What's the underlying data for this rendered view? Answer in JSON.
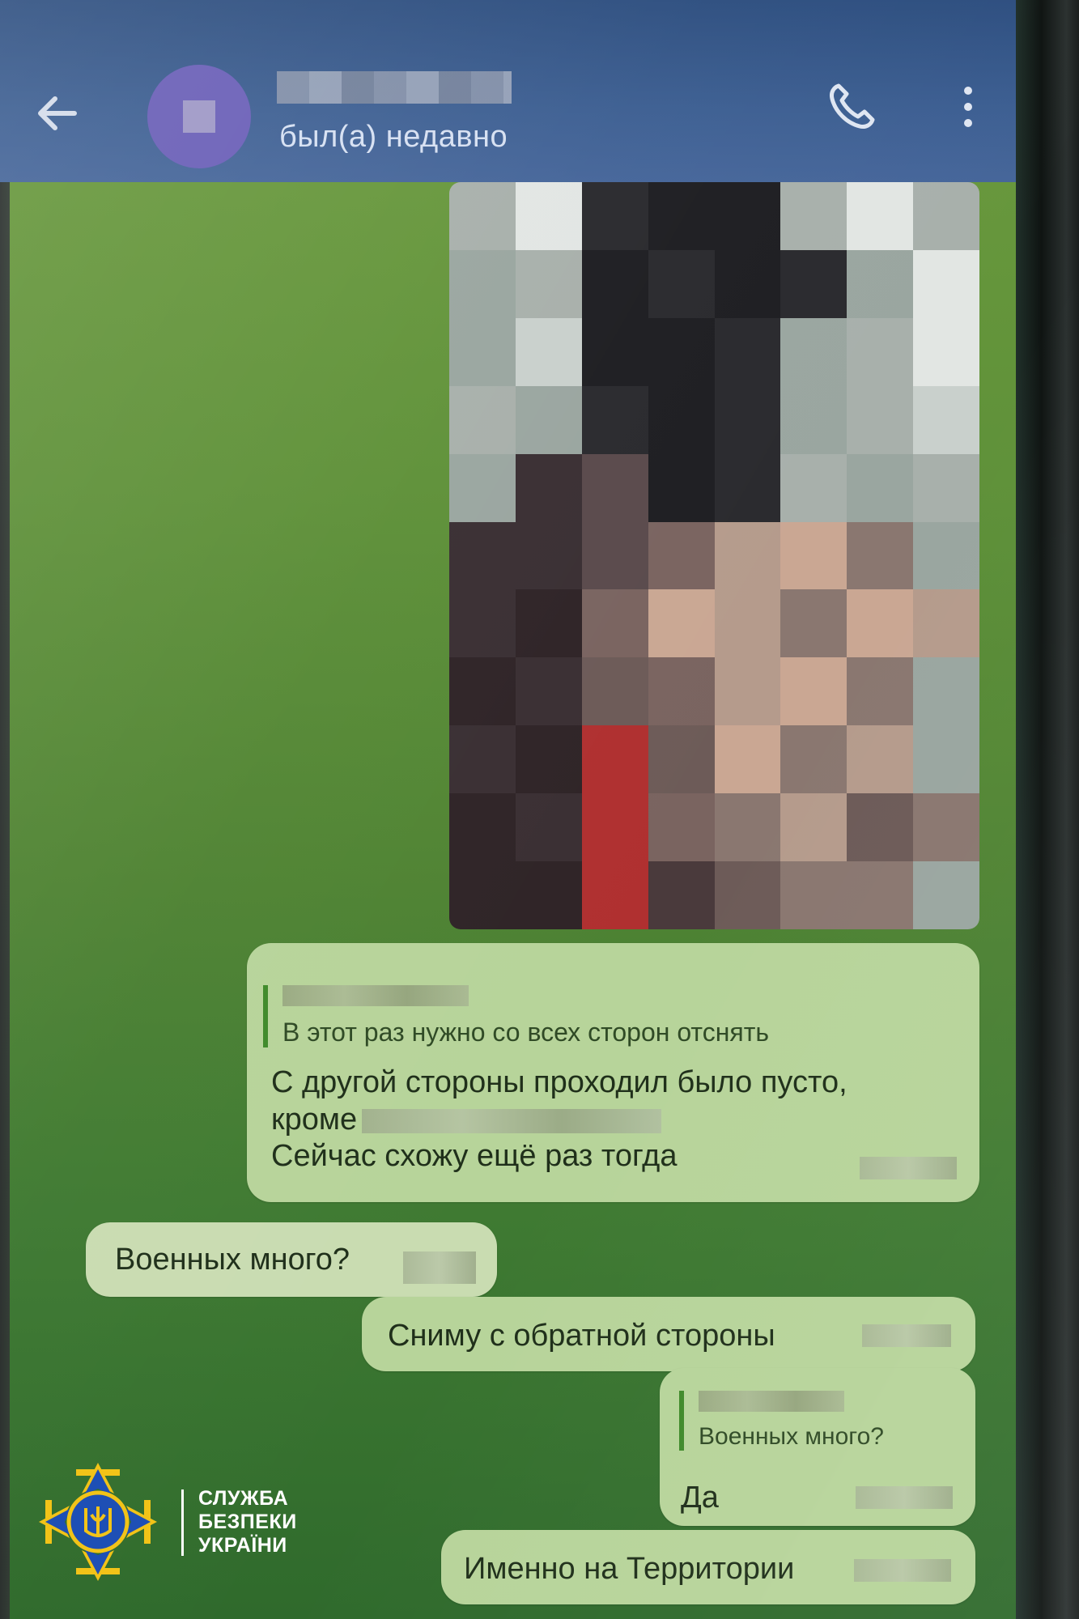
{
  "header": {
    "status": "был(а) недавно"
  },
  "messages": {
    "m1": {
      "reply_text": "В этот раз нужно со всех сторон отснять",
      "line1": "С другой стороны проходил было пусто,",
      "line2": "кроме",
      "line3": "Сейчас схожу ещё раз тогда"
    },
    "m2": {
      "text": "Военных много?"
    },
    "m3": {
      "text": "Сниму с обратной стороны"
    },
    "m4": {
      "reply_text": "Военных много?",
      "text": "Да"
    },
    "m5": {
      "text": "Именно на Территории"
    }
  },
  "watermark": {
    "line1": "СЛУЖБА",
    "line2": "БЕЗПЕКИ",
    "line3": "УКРАЇНИ"
  },
  "colors": {
    "header_bg": "#3d5f92",
    "chat_bg": "#5f9139",
    "bubble": "#b7d49a",
    "reply_bar": "#3f8a2a",
    "logo_blue": "#1e4fb5",
    "logo_gold": "#f2c318"
  },
  "icons": [
    "back-arrow-icon",
    "phone-icon",
    "more-vertical-icon",
    "sbu-emblem-icon"
  ]
}
